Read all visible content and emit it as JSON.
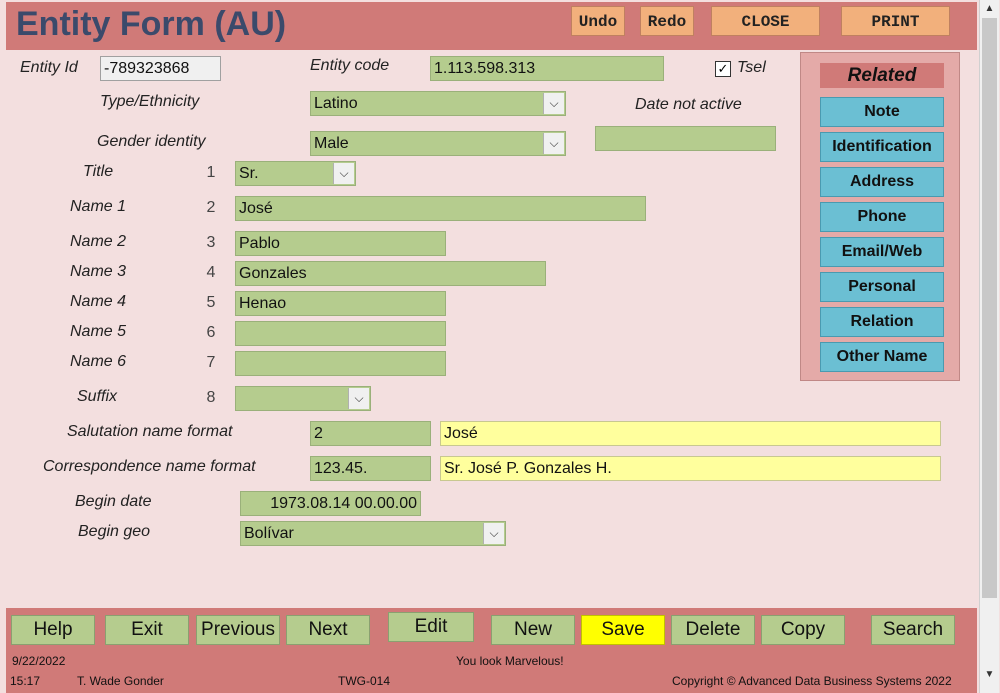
{
  "header": {
    "title": "Entity Form (AU)",
    "buttons": {
      "undo": "Undo",
      "redo": "Redo",
      "close": "CLOSE",
      "print": "PRINT"
    }
  },
  "form": {
    "entity_id": {
      "label": "Entity Id",
      "value": "-789323868"
    },
    "entity_code": {
      "label": "Entity code",
      "value": "1.113.598.313"
    },
    "tsel": {
      "label": "Tsel",
      "checked": true
    },
    "type_ethnicity": {
      "label": "Type/Ethnicity",
      "value": "Latino"
    },
    "date_not_active": {
      "label": "Date not active",
      "value": ""
    },
    "gender_identity": {
      "label": "Gender identity",
      "value": "Male"
    },
    "title": {
      "label": "Title",
      "num": "1",
      "value": "Sr."
    },
    "name1": {
      "label": "Name 1",
      "num": "2",
      "value": "José"
    },
    "name2": {
      "label": "Name 2",
      "num": "3",
      "value": "Pablo"
    },
    "name3": {
      "label": "Name 3",
      "num": "4",
      "value": "Gonzales"
    },
    "name4": {
      "label": "Name 4",
      "num": "5",
      "value": "Henao"
    },
    "name5": {
      "label": "Name 5",
      "num": "6",
      "value": ""
    },
    "name6": {
      "label": "Name 6",
      "num": "7",
      "value": ""
    },
    "suffix": {
      "label": "Suffix",
      "num": "8",
      "value": ""
    },
    "salutation": {
      "label": "Salutation name format",
      "code": "2",
      "value": "José"
    },
    "correspondence": {
      "label": "Correspondence name format",
      "code": "123.45.",
      "value": "Sr. José P. Gonzales H."
    },
    "begin_date": {
      "label": "Begin date",
      "value": "1973.08.14 00.00.00"
    },
    "begin_geo": {
      "label": "Begin geo",
      "value": "Bolívar"
    }
  },
  "related": {
    "title": "Related",
    "items": [
      "Note",
      "Identification",
      "Address",
      "Phone",
      "Email/Web",
      "Personal",
      "Relation",
      "Other Name"
    ]
  },
  "footer": {
    "buttons": [
      "Help",
      "Exit",
      "Previous",
      "Next",
      "Edit",
      "New",
      "Save",
      "Delete",
      "Copy",
      "Search"
    ],
    "date": "9/22/2022",
    "message": "You look Marvelous!",
    "time": "15:17",
    "user": "T. Wade Gonder",
    "code": "TWG-014",
    "copyright": "Copyright © Advanced Data Business Systems 2022"
  },
  "colors": {
    "header": "#d07a78",
    "field": "#b5cc8e",
    "related_button": "#6bbfd3",
    "save": "#ffff00"
  }
}
